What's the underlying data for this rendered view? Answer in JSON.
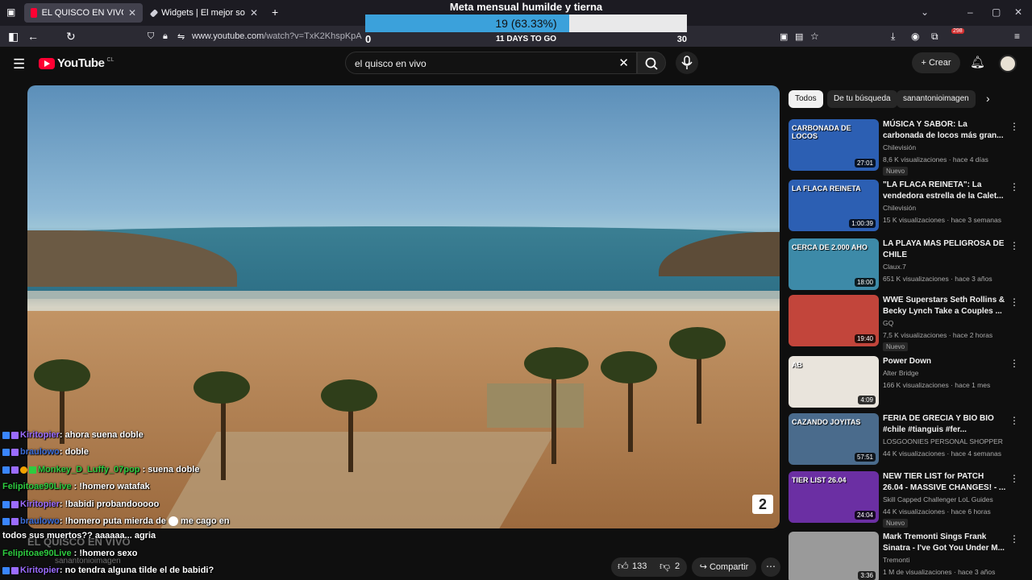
{
  "browser": {
    "tabs": [
      {
        "title": "EL QUISCO EN VIVO - YouTube",
        "color": "#ff0033"
      },
      {
        "title": "Widgets | El mejor software par",
        "color": "#cfcfd8"
      }
    ],
    "url_host": "www.youtube.com",
    "url_path": "/watch?v=TxK2KhspKpA",
    "ext_badge": "298"
  },
  "goal": {
    "title": "Meta mensual humilde y tierna",
    "current_label": "19 (63.33%)",
    "progress_percent": 63.33,
    "min": "0",
    "days_left": "11 DAYS TO GO",
    "max": "30",
    "fill_color": "#3ba1db"
  },
  "youtube": {
    "logo_text": "YouTube",
    "country": "CL",
    "search_query": "el quisco en vivo",
    "create_label": "Crear",
    "video_title": "EL QUISCO EN VIVO",
    "channel": "sanantonioimagen",
    "like_count": "133",
    "dislike_count": "2",
    "share_label": "Compartir",
    "watermark": "2"
  },
  "chat": [
    {
      "user": "Kiritopier",
      "text": ": ahora suena doble",
      "color": "#9b6cff"
    },
    {
      "user": "braulowo",
      "text": ": doble",
      "color": "#3c6ed8"
    },
    {
      "user": "Monkey_D_Luffy_07pop",
      "text": " : suena doble",
      "color": "#2ecc40"
    },
    {
      "user": "Felipitoae90Live",
      "text": " : !homero watafak",
      "color": "#2ecc40"
    },
    {
      "user": "Kiritopier",
      "text": ": !babidi probandooooo",
      "color": "#9b6cff"
    },
    {
      "user": "braulowo",
      "text": ": !homero puta mierda de",
      "suffix": " me cago en",
      "color": "#3c6ed8"
    },
    {
      "user": "",
      "text": "todos sus muertos?? aaaaaa... agria",
      "color": "#ffffff"
    },
    {
      "user": "Felipitoae90Live",
      "text": " : !homero sexo",
      "color": "#2ecc40"
    },
    {
      "user": "Kiritopier",
      "text": ": no tendra alguna tilde el de babidi?",
      "color": "#9b6cff"
    }
  ],
  "chips": [
    {
      "label": "Todos"
    },
    {
      "label": "De tu búsqueda"
    },
    {
      "label": "sanantonioimagen"
    }
  ],
  "related": [
    {
      "title1": "MÚSICA Y SABOR: La",
      "title2": "carbonada de locos más gran...",
      "channel": "Chilevisión",
      "meta": "8,6 K visualizaciones · hace 4 días",
      "badge": "Nuevo",
      "duration": "27:01",
      "thumb_text": "CARBONADA DE LOCOS",
      "thumb_color": "#2c5fb3"
    },
    {
      "title1": "\"LA FLACA REINETA\": La",
      "title2": "vendedora estrella de la Calet...",
      "channel": "Chilevisión",
      "meta": "15 K visualizaciones · hace 3 semanas",
      "badge": "",
      "duration": "1:00:39",
      "thumb_text": "LA FLACA REINETA",
      "thumb_color": "#2c5fb3"
    },
    {
      "title1": "LA PLAYA MAS PELIGROSA DE",
      "title2": "CHILE",
      "channel": "Claux.7",
      "meta": "651 K visualizaciones · hace 3 años",
      "badge": "",
      "duration": "18:00",
      "thumb_text": "CERCA DE 2.000 AHO",
      "thumb_color": "#3d8aa8"
    },
    {
      "title1": "WWE Superstars Seth Rollins &",
      "title2": "Becky Lynch Take a Couples ...",
      "channel": "GQ",
      "meta": "7,5 K visualizaciones · hace 2 horas",
      "badge": "Nuevo",
      "duration": "19:40",
      "thumb_text": "",
      "thumb_color": "#c2453b"
    },
    {
      "title1": "Power Down",
      "title2": "",
      "channel": "Alter Bridge",
      "meta": "166 K visualizaciones · hace 1 mes",
      "badge": "",
      "duration": "4:09",
      "thumb_text": "AB",
      "thumb_color": "#e9e4dc"
    },
    {
      "title1": "FERIA DE GRECIA Y BIO BIO",
      "title2": "#chile #tianguis #fer...",
      "channel": "LOSGOONIES PERSONAL SHOPPER",
      "meta": "44 K visualizaciones · hace 4 semanas",
      "badge": "",
      "duration": "57:51",
      "thumb_text": "CAZANDO JOYITAS",
      "thumb_color": "#4a6b8c"
    },
    {
      "title1": "NEW TIER LIST for PATCH",
      "title2": "26.04 - MASSIVE CHANGES! - ...",
      "channel": "Skill Capped Challenger LoL Guides",
      "meta": "44 K visualizaciones · hace 6 horas",
      "badge": "Nuevo",
      "duration": "24:04",
      "thumb_text": "TIER LIST 26.04",
      "thumb_color": "#6b2fa3"
    },
    {
      "title1": "Mark Tremonti Sings Frank",
      "title2": "Sinatra - I've Got You Under M...",
      "channel": "Tremonti",
      "meta": "1 M de visualizaciones · hace 3 años",
      "badge": "",
      "duration": "3:36",
      "thumb_text": "",
      "thumb_color": "#9a9a9a"
    }
  ]
}
